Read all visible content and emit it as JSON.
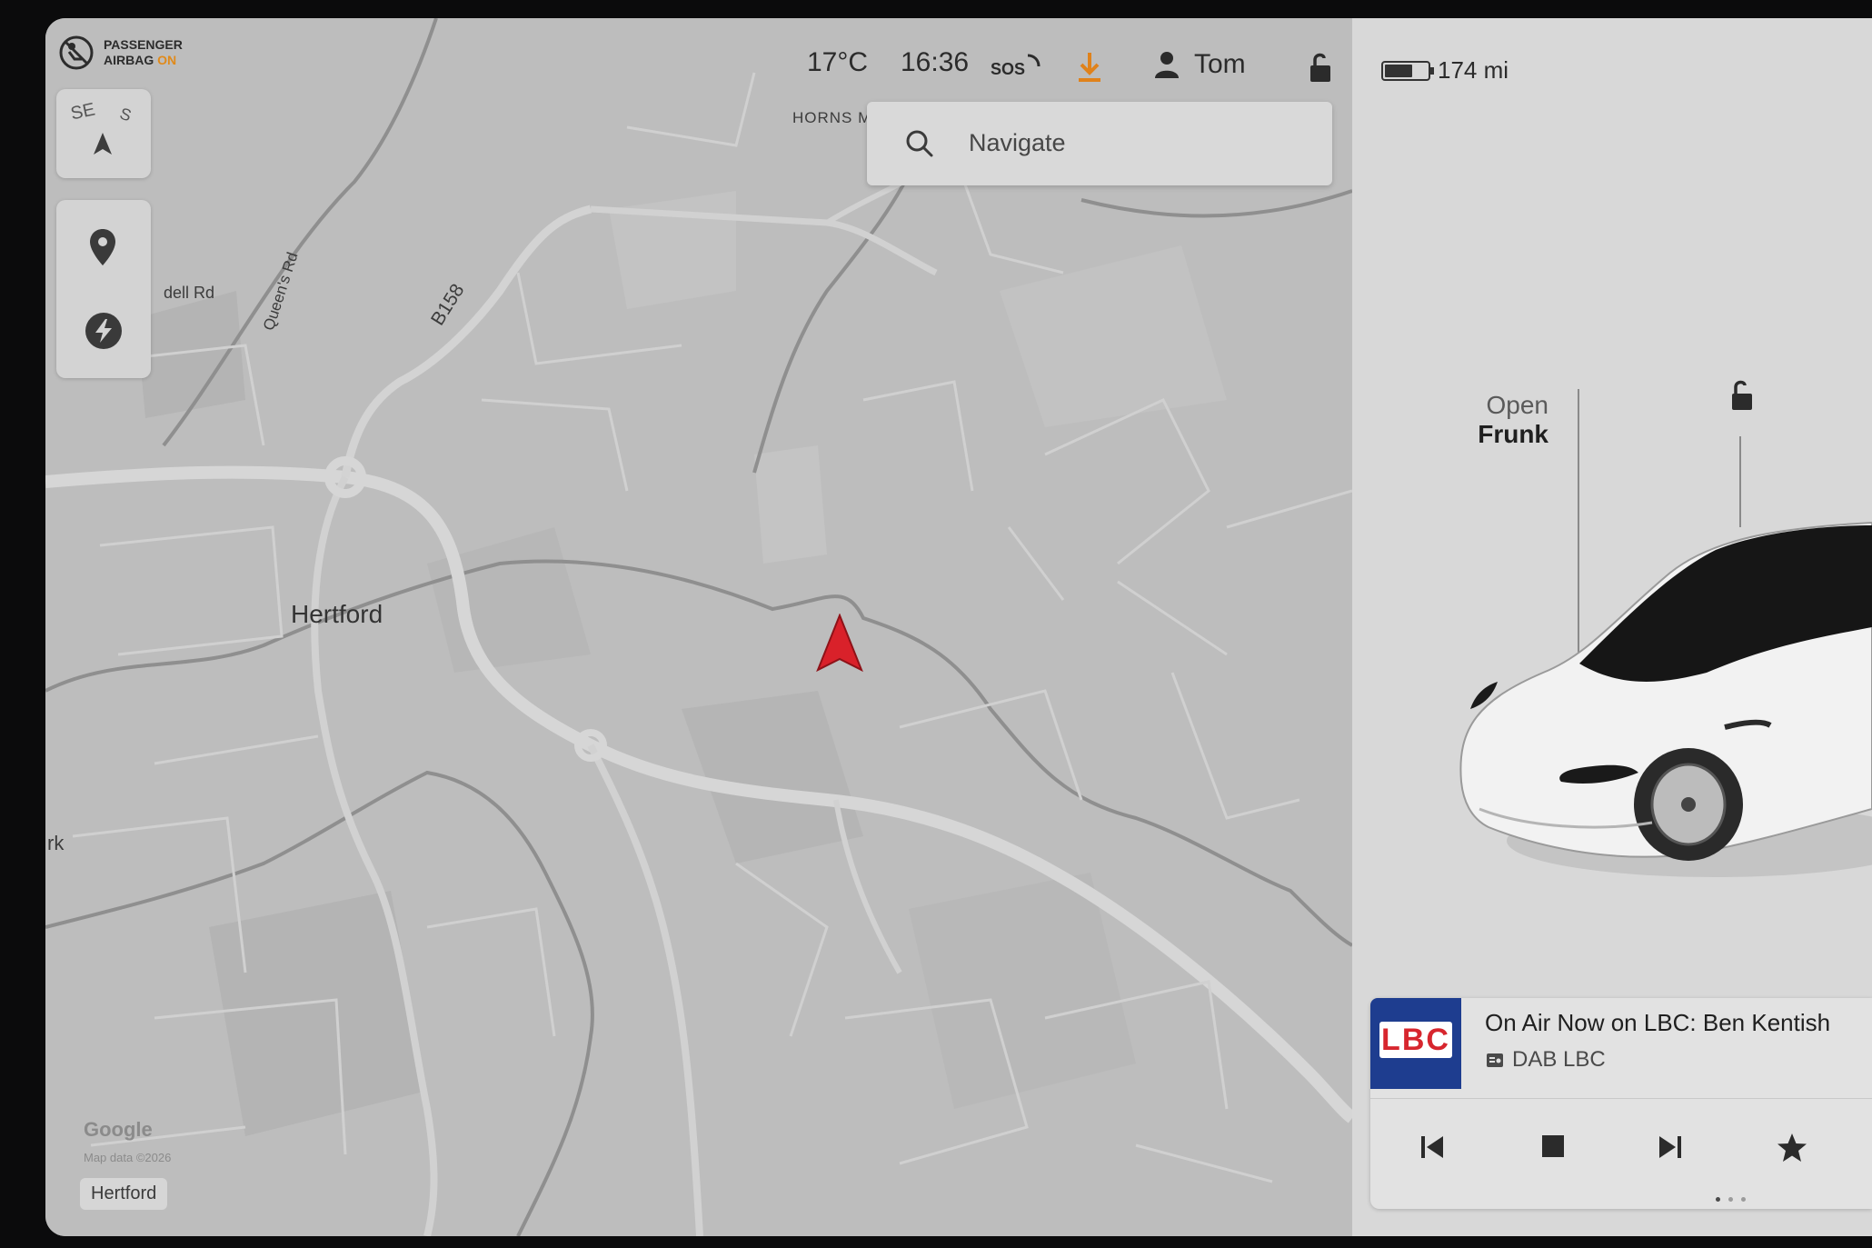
{
  "status_bar": {
    "airbag_line1": "PASSENGER",
    "airbag_line2": "AIRBAG",
    "airbag_state": "ON",
    "temperature": "17°C",
    "time": "16:36",
    "sos": "SOS",
    "user": "Tom",
    "range": "174 mi",
    "battery_fraction": 0.6
  },
  "compass": {
    "left": "SE",
    "right": "S"
  },
  "search": {
    "placeholder": "Navigate"
  },
  "map": {
    "labels": {
      "hertford": "Hertford",
      "b158": "B158",
      "queens_rd": "Queen's Rd",
      "dell_rd": "dell Rd",
      "horns_mill": "HORNS MILL",
      "rk": "rk",
      "google": "Google",
      "map_data": "Map data ©2026",
      "location_chip": "Hertford"
    }
  },
  "car_panel": {
    "frunk_line1": "Open",
    "frunk_line2": "Frunk"
  },
  "media": {
    "station_logo": "LBC",
    "title": "On Air Now on LBC: Ben Kentish",
    "source": "DAB LBC"
  },
  "colors": {
    "accent_orange": "#e0821b",
    "nav_arrow": "#d9212a",
    "lbc_blue": "#1e3d8f",
    "lbc_red": "#d7262e"
  }
}
